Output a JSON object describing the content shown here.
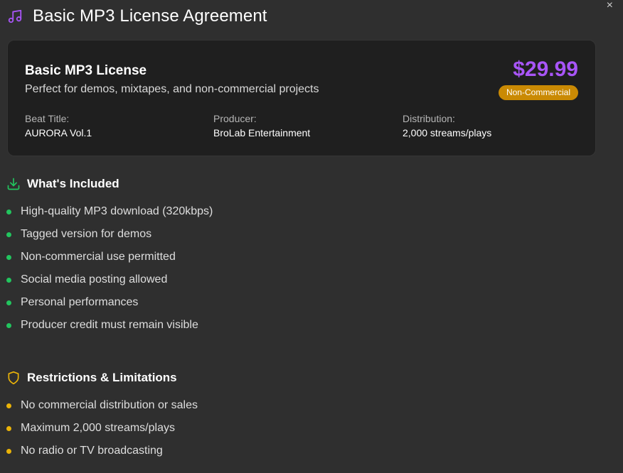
{
  "dialog": {
    "title": "Basic MP3 License Agreement",
    "close_label": "×"
  },
  "license": {
    "name": "Basic MP3 License",
    "description": "Perfect for demos, mixtapes, and non-commercial projects",
    "price": "$29.99",
    "badge": "Non-Commercial",
    "details": [
      {
        "label": "Beat Title:",
        "value": "AURORA Vol.1"
      },
      {
        "label": "Producer:",
        "value": "BroLab Entertainment"
      },
      {
        "label": "Distribution:",
        "value": "2,000 streams/plays"
      }
    ]
  },
  "included": {
    "title": "What's Included",
    "items": [
      "High-quality MP3 download (320kbps)",
      "Tagged version for demos",
      "Non-commercial use permitted",
      "Social media posting allowed",
      "Personal performances",
      "Producer credit must remain visible"
    ]
  },
  "restrictions": {
    "title": "Restrictions & Limitations",
    "items": [
      "No commercial distribution or sales",
      "Maximum 2,000 streams/plays",
      "No radio or TV broadcasting"
    ]
  },
  "colors": {
    "background": "#2f2f2f",
    "card": "#1f1f1f",
    "accent_purple": "#a855f7",
    "badge": "#ca8a04",
    "included_green": "#22c55e",
    "restriction_yellow": "#eab308"
  },
  "icons": {
    "header": "music-note-icon",
    "included": "download-icon",
    "restrictions": "shield-icon",
    "close": "close-icon"
  }
}
